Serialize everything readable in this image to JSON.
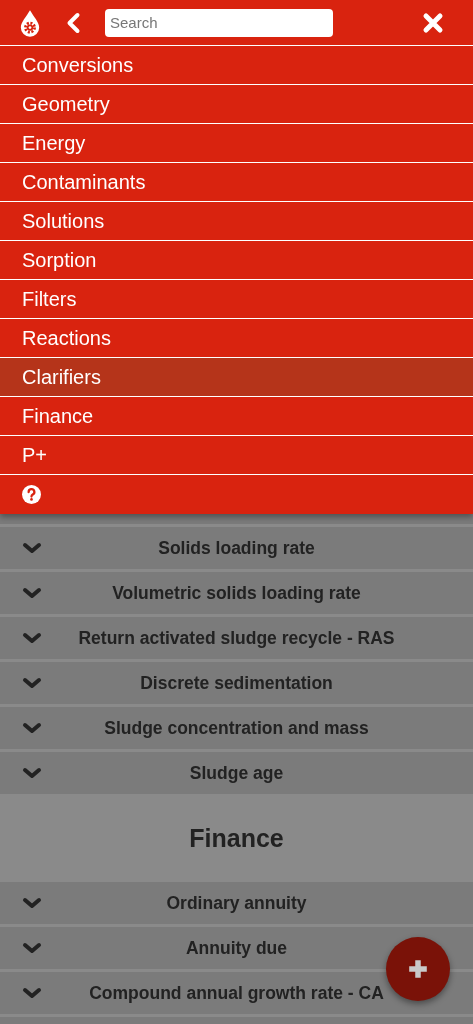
{
  "header": {
    "search": {
      "placeholder": "Search"
    }
  },
  "menu": [
    {
      "label": "Conversions",
      "selected": false
    },
    {
      "label": "Geometry",
      "selected": false
    },
    {
      "label": "Energy",
      "selected": false
    },
    {
      "label": "Contaminants",
      "selected": false
    },
    {
      "label": "Solutions",
      "selected": false
    },
    {
      "label": "Sorption",
      "selected": false
    },
    {
      "label": "Filters",
      "selected": false
    },
    {
      "label": "Reactions",
      "selected": false
    },
    {
      "label": "Clarifiers",
      "selected": true
    },
    {
      "label": "Finance",
      "selected": false
    },
    {
      "label": "P+",
      "selected": false
    }
  ],
  "sections": [
    {
      "kind": "rows",
      "rows": [
        "Solids loading rate",
        "Volumetric solids loading rate",
        "Return activated sludge recycle - RAS",
        "Discrete sedimentation",
        "Sludge concentration and mass",
        "Sludge age"
      ]
    },
    {
      "kind": "heading",
      "title": "Finance"
    },
    {
      "kind": "rows",
      "rows": [
        "Ordinary annuity",
        "Annuity due",
        "Compound annual growth rate - CA"
      ]
    }
  ]
}
